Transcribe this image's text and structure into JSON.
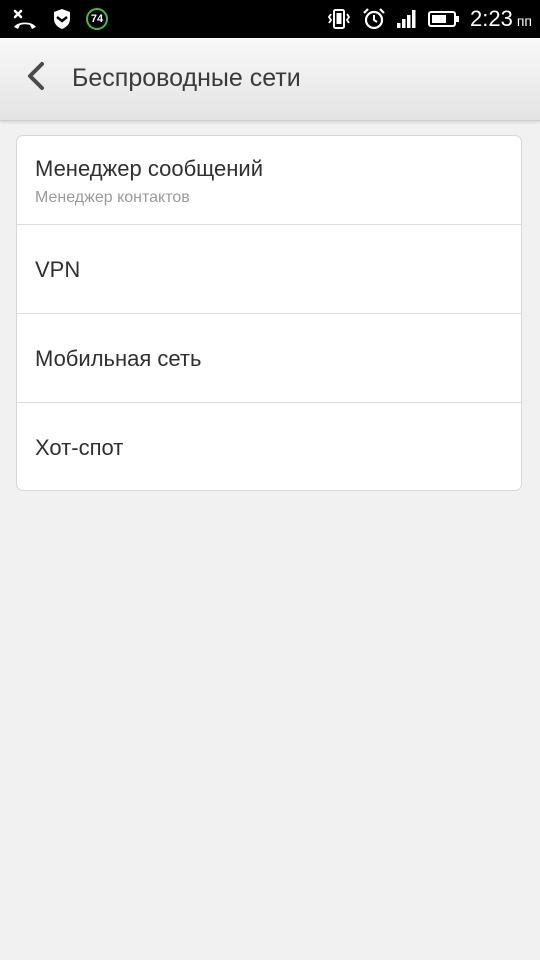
{
  "status_bar": {
    "icons_left": [
      "missed-call-icon",
      "shield-icon",
      "battery-percent-icon"
    ],
    "battery_percent": "74",
    "icons_right": [
      "vibrate-icon",
      "alarm-icon",
      "signal-icon",
      "battery-icon"
    ],
    "time": "2:23",
    "ampm": "пп",
    "accent_color": "#3fbf3f"
  },
  "header": {
    "back_icon": "chevron-left-icon",
    "title": "Беспроводные сети"
  },
  "list": {
    "items": [
      {
        "label": "Менеджер сообщений",
        "sublabel": "Менеджер контактов"
      },
      {
        "label": "VPN"
      },
      {
        "label": "Мобильная сеть"
      },
      {
        "label": "Хот-спот"
      }
    ]
  }
}
